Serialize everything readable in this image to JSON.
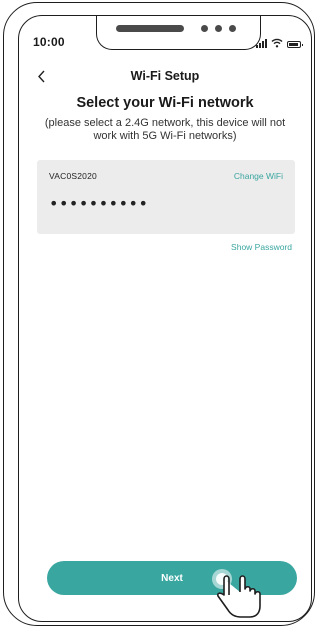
{
  "status_bar": {
    "time": "10:00",
    "icons": [
      "signal-icon",
      "wifi-icon",
      "battery-icon"
    ]
  },
  "header": {
    "title": "Wi-Fi Setup",
    "back_icon": "chevron-left-icon"
  },
  "content": {
    "heading": "Select your Wi-Fi network",
    "subtext": "(please select a 2.4G network, this device will not work with 5G Wi-Fi networks)"
  },
  "network": {
    "ssid": "VAC0S2020",
    "change_label": "Change WiFi",
    "password_value": "••••••••••",
    "show_password_label": "Show Password"
  },
  "actions": {
    "next_label": "Next"
  },
  "colors": {
    "accent": "#3aa6a0",
    "card_bg": "#ececec"
  }
}
